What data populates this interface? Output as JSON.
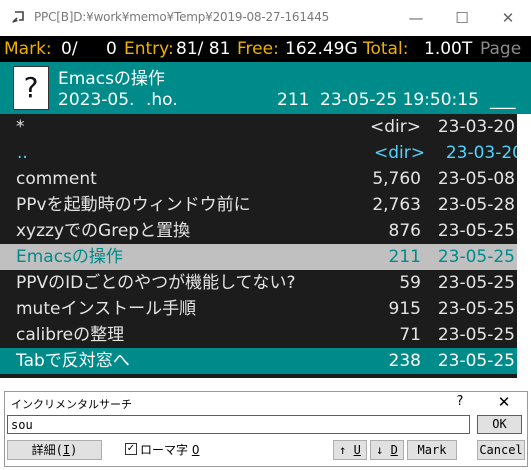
{
  "window": {
    "title": "PPC[B]D:¥work¥memo¥Temp¥2019-08-27-161445",
    "controls": {
      "minimize": "—",
      "maximize": "☐",
      "close": "✕"
    }
  },
  "status": {
    "mark_label": "Mark:",
    "mark_value": "0/",
    "mark_count": "0",
    "entry_label": "Entry:",
    "entry_value": "81/ 81",
    "free_label": "Free:",
    "free_value": "162.49G",
    "total_label": "Total:",
    "total_value": "1.00T",
    "page_label": "Page"
  },
  "header": {
    "icon_glyph": "?",
    "file_name": "Emacsの操作",
    "info_date": "2023-05.",
    "info_ext": ".ho.",
    "info_size": "211",
    "info_timestamp": "23-05-25 19:50:15",
    "info_tail": "___"
  },
  "files": [
    {
      "name": "*",
      "size": "<dir>",
      "date": "23-03-20"
    },
    {
      "name": "..",
      "size": "<dir>",
      "date": "23-03-20"
    },
    {
      "name": "comment",
      "size": "5,760",
      "date": "23-05-08"
    },
    {
      "name": "PPvを起動時のウィンドウ前に",
      "size": "2,763",
      "date": "23-05-28"
    },
    {
      "name": "xyzzyでのGrepと置換",
      "size": "876",
      "date": "23-05-25"
    },
    {
      "name": "Emacsの操作",
      "size": "211",
      "date": "23-05-25"
    },
    {
      "name": "PPVのIDごとのやつが機能してない?",
      "size": "59",
      "date": "23-05-25"
    },
    {
      "name": "muteインストール手順",
      "size": "915",
      "date": "23-05-25"
    },
    {
      "name": "calibreの整理",
      "size": "71",
      "date": "23-05-25"
    },
    {
      "name": "Tabで反対窓へ",
      "size": "238",
      "date": "23-05-25"
    }
  ],
  "dialog": {
    "title": "インクリメンタルサーチ",
    "help": "?",
    "close": "✕",
    "search_value": "sou",
    "ok_label": "OK",
    "detail_label": "詳細(",
    "detail_key": "I",
    "detail_tail": ")",
    "checkbox_mark": "✓",
    "romaji_label": "ローマ字",
    "romaji_key": "0",
    "up_label": "↑",
    "up_key": "U",
    "down_label": "↓",
    "down_key": "D",
    "mark_label": "Mark",
    "cancel_label": "Cancel"
  },
  "colors": {
    "status_label": "#f0b000",
    "header_bg": "#008b8b",
    "list_bg": "#1c1c1c",
    "cursor_bg": "#c0c0c0",
    "parent_dir": "#4fd4ff"
  }
}
